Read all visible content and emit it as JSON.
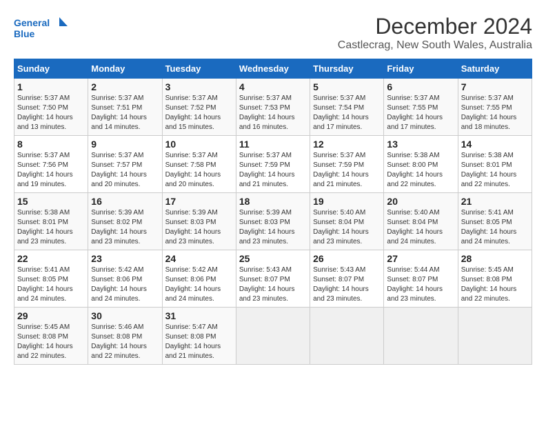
{
  "header": {
    "logo_line1": "General",
    "logo_line2": "Blue",
    "main_title": "December 2024",
    "subtitle": "Castlecrag, New South Wales, Australia"
  },
  "calendar": {
    "days_of_week": [
      "Sunday",
      "Monday",
      "Tuesday",
      "Wednesday",
      "Thursday",
      "Friday",
      "Saturday"
    ],
    "weeks": [
      [
        {
          "day": "",
          "info": ""
        },
        {
          "day": "2",
          "info": "Sunrise: 5:37 AM\nSunset: 7:51 PM\nDaylight: 14 hours\nand 14 minutes."
        },
        {
          "day": "3",
          "info": "Sunrise: 5:37 AM\nSunset: 7:52 PM\nDaylight: 14 hours\nand 15 minutes."
        },
        {
          "day": "4",
          "info": "Sunrise: 5:37 AM\nSunset: 7:53 PM\nDaylight: 14 hours\nand 16 minutes."
        },
        {
          "day": "5",
          "info": "Sunrise: 5:37 AM\nSunset: 7:54 PM\nDaylight: 14 hours\nand 17 minutes."
        },
        {
          "day": "6",
          "info": "Sunrise: 5:37 AM\nSunset: 7:55 PM\nDaylight: 14 hours\nand 17 minutes."
        },
        {
          "day": "7",
          "info": "Sunrise: 5:37 AM\nSunset: 7:55 PM\nDaylight: 14 hours\nand 18 minutes."
        }
      ],
      [
        {
          "day": "8",
          "info": "Sunrise: 5:37 AM\nSunset: 7:56 PM\nDaylight: 14 hours\nand 19 minutes."
        },
        {
          "day": "9",
          "info": "Sunrise: 5:37 AM\nSunset: 7:57 PM\nDaylight: 14 hours\nand 20 minutes."
        },
        {
          "day": "10",
          "info": "Sunrise: 5:37 AM\nSunset: 7:58 PM\nDaylight: 14 hours\nand 20 minutes."
        },
        {
          "day": "11",
          "info": "Sunrise: 5:37 AM\nSunset: 7:59 PM\nDaylight: 14 hours\nand 21 minutes."
        },
        {
          "day": "12",
          "info": "Sunrise: 5:37 AM\nSunset: 7:59 PM\nDaylight: 14 hours\nand 21 minutes."
        },
        {
          "day": "13",
          "info": "Sunrise: 5:38 AM\nSunset: 8:00 PM\nDaylight: 14 hours\nand 22 minutes."
        },
        {
          "day": "14",
          "info": "Sunrise: 5:38 AM\nSunset: 8:01 PM\nDaylight: 14 hours\nand 22 minutes."
        }
      ],
      [
        {
          "day": "15",
          "info": "Sunrise: 5:38 AM\nSunset: 8:01 PM\nDaylight: 14 hours\nand 23 minutes."
        },
        {
          "day": "16",
          "info": "Sunrise: 5:39 AM\nSunset: 8:02 PM\nDaylight: 14 hours\nand 23 minutes."
        },
        {
          "day": "17",
          "info": "Sunrise: 5:39 AM\nSunset: 8:03 PM\nDaylight: 14 hours\nand 23 minutes."
        },
        {
          "day": "18",
          "info": "Sunrise: 5:39 AM\nSunset: 8:03 PM\nDaylight: 14 hours\nand 23 minutes."
        },
        {
          "day": "19",
          "info": "Sunrise: 5:40 AM\nSunset: 8:04 PM\nDaylight: 14 hours\nand 23 minutes."
        },
        {
          "day": "20",
          "info": "Sunrise: 5:40 AM\nSunset: 8:04 PM\nDaylight: 14 hours\nand 24 minutes."
        },
        {
          "day": "21",
          "info": "Sunrise: 5:41 AM\nSunset: 8:05 PM\nDaylight: 14 hours\nand 24 minutes."
        }
      ],
      [
        {
          "day": "22",
          "info": "Sunrise: 5:41 AM\nSunset: 8:05 PM\nDaylight: 14 hours\nand 24 minutes."
        },
        {
          "day": "23",
          "info": "Sunrise: 5:42 AM\nSunset: 8:06 PM\nDaylight: 14 hours\nand 24 minutes."
        },
        {
          "day": "24",
          "info": "Sunrise: 5:42 AM\nSunset: 8:06 PM\nDaylight: 14 hours\nand 24 minutes."
        },
        {
          "day": "25",
          "info": "Sunrise: 5:43 AM\nSunset: 8:07 PM\nDaylight: 14 hours\nand 23 minutes."
        },
        {
          "day": "26",
          "info": "Sunrise: 5:43 AM\nSunset: 8:07 PM\nDaylight: 14 hours\nand 23 minutes."
        },
        {
          "day": "27",
          "info": "Sunrise: 5:44 AM\nSunset: 8:07 PM\nDaylight: 14 hours\nand 23 minutes."
        },
        {
          "day": "28",
          "info": "Sunrise: 5:45 AM\nSunset: 8:08 PM\nDaylight: 14 hours\nand 22 minutes."
        }
      ],
      [
        {
          "day": "29",
          "info": "Sunrise: 5:45 AM\nSunset: 8:08 PM\nDaylight: 14 hours\nand 22 minutes."
        },
        {
          "day": "30",
          "info": "Sunrise: 5:46 AM\nSunset: 8:08 PM\nDaylight: 14 hours\nand 22 minutes."
        },
        {
          "day": "31",
          "info": "Sunrise: 5:47 AM\nSunset: 8:08 PM\nDaylight: 14 hours\nand 21 minutes."
        },
        {
          "day": "",
          "info": ""
        },
        {
          "day": "",
          "info": ""
        },
        {
          "day": "",
          "info": ""
        },
        {
          "day": "",
          "info": ""
        }
      ]
    ],
    "first_week_sunday": {
      "day": "1",
      "info": "Sunrise: 5:37 AM\nSunset: 7:50 PM\nDaylight: 14 hours\nand 13 minutes."
    }
  }
}
